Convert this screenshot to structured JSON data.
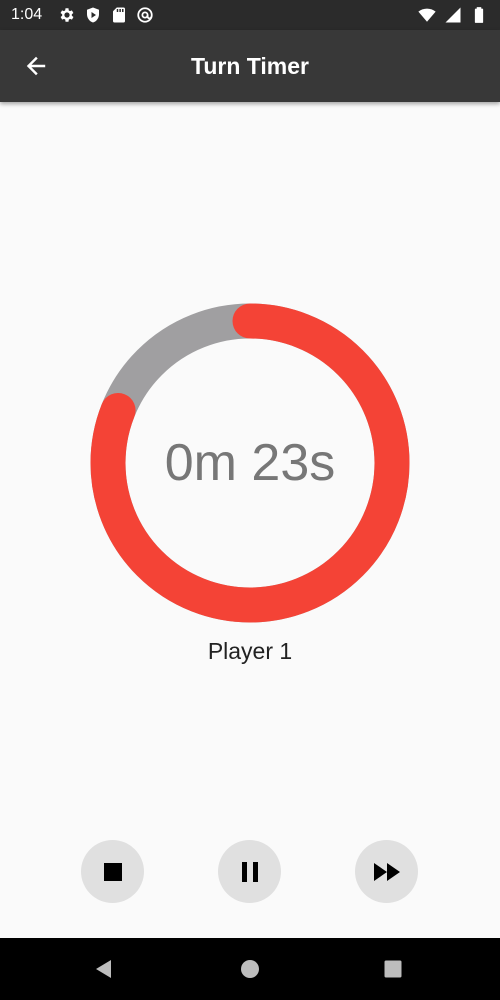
{
  "status_bar": {
    "time": "1:04",
    "left_icons": [
      "gear-icon",
      "shield-play-icon",
      "sd-card-icon",
      "at-sign-icon"
    ],
    "right_icons": [
      "wifi-icon",
      "signal-icon",
      "battery-icon"
    ]
  },
  "app_bar": {
    "title": "Turn Timer",
    "back_icon": "arrow-left-icon"
  },
  "timer": {
    "display": "0m 23s",
    "player": "Player 1",
    "progress_fraction": 0.81,
    "colors": {
      "progress": "#f44336",
      "track": "#a09fa1",
      "text": "#777777"
    }
  },
  "controls": [
    {
      "name": "stop",
      "icon": "stop-icon"
    },
    {
      "name": "pause",
      "icon": "pause-icon"
    },
    {
      "name": "skip",
      "icon": "fast-forward-icon"
    }
  ],
  "nav_bar": {
    "icons": [
      "back-triangle-icon",
      "home-circle-icon",
      "recents-square-icon"
    ]
  }
}
